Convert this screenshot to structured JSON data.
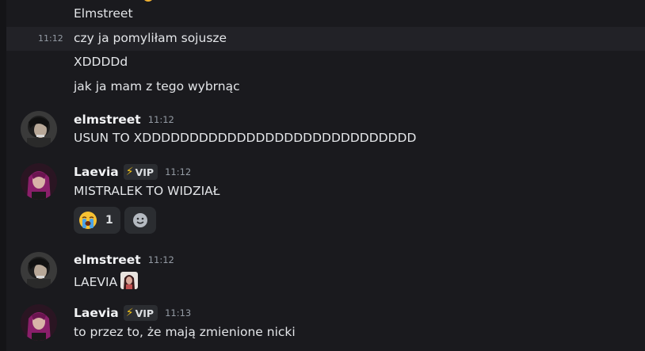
{
  "messages": {
    "m1": "Elmstreet",
    "m2": {
      "time": "11:12",
      "text": "czy ja pomyliłam sojusze"
    },
    "m3": "XDDDDd",
    "m4": "jak ja mam z tego wybrnąc",
    "m5": {
      "user": "elmstreet",
      "time": "11:12",
      "text": "USUN TO XDDDDDDDDDDDDDDDDDDDDDDDDDDDDD"
    },
    "m6": {
      "user": "Laevia",
      "badge": "VIP",
      "time": "11:12",
      "text": "MISTRALEK TO WIDZIAŁ"
    },
    "m6_reactions": {
      "emoji": "loudly-crying-face",
      "count": "1",
      "add_icon": "add-reaction-icon"
    },
    "m7": {
      "user": "elmstreet",
      "time": "11:12",
      "text": "LAEVIA"
    },
    "m8": {
      "user": "Laevia",
      "badge": "VIP",
      "time": "11:13",
      "text": "to przez to, że mają zmienione nicki"
    }
  },
  "colors": {
    "background": "#1a1a1e",
    "highlight": "#222227",
    "badge_bg": "#2b2d31",
    "bolt": "#f5c518"
  }
}
